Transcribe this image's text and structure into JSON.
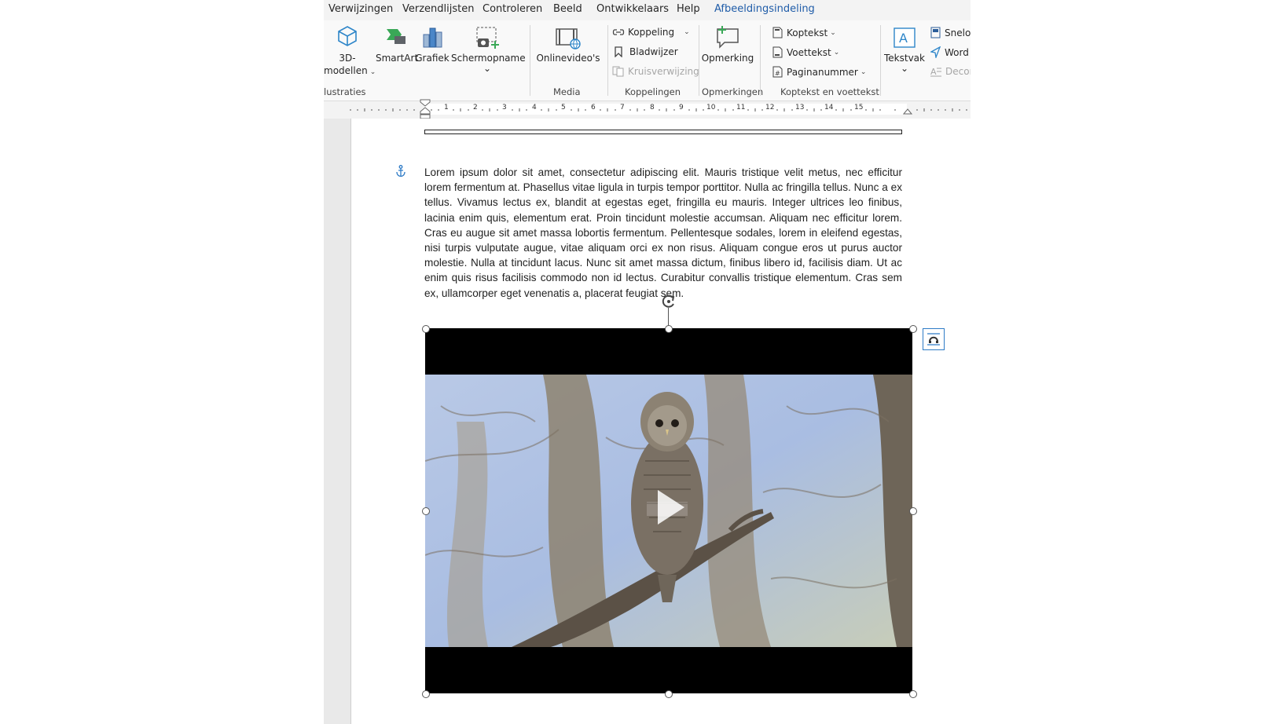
{
  "menu": {
    "items": [
      "Verwijzingen",
      "Verzendlijsten",
      "Controleren",
      "Beeld",
      "Ontwikkelaars",
      "Help",
      "Afbeeldingsindeling"
    ]
  },
  "ribbon": {
    "illustraties": {
      "models3d_line1": "3D-",
      "models3d_line2": "modellen",
      "smartart": "SmartArt",
      "grafiek": "Grafiek",
      "schermopname": "Schermopname",
      "group_label": "lustraties"
    },
    "media": {
      "onlinevideos": "Onlinevideo's",
      "group_label": "Media"
    },
    "koppelingen": {
      "koppeling": "Koppeling",
      "bladwijzer": "Bladwijzer",
      "kruisverwijzing": "Kruisverwijzing",
      "group_label": "Koppelingen"
    },
    "opmerkingen": {
      "opmerking": "Opmerking",
      "group_label": "Opmerkingen"
    },
    "koptekst": {
      "koptekst": "Koptekst",
      "voettekst": "Voettekst",
      "paginanummer": "Paginanummer",
      "group_label": "Koptekst en voettekst"
    },
    "tekst": {
      "tekstvak": "Tekstvak",
      "snelonderdelen": "Snelo",
      "wordart": "Word",
      "decor": "Decor"
    }
  },
  "ruler": {
    "numbers": [
      "1",
      "2",
      "3",
      "4",
      "5",
      "6",
      "7",
      "8",
      "9",
      "10",
      "11",
      "12",
      "13",
      "14",
      "15"
    ]
  },
  "document": {
    "paragraph": "Lorem ipsum dolor sit amet, consectetur adipiscing elit. Mauris tristique velit metus, nec efficitur lorem fermentum at. Phasellus vitae ligula in turpis tempor porttitor. Nulla ac fringilla tellus. Nunc a ex tellus. Vivamus lectus ex, blandit at egestas eget, fringilla eu mauris. Integer ultrices leo finibus, lacinia enim quis, elementum erat. Proin tincidunt molestie accumsan. Aliquam nec efficitur lorem. Cras eu augue sit amet massa lobortis fermentum. Pellentesque sodales, lorem in eleifend egestas, nisi turpis vulputate augue, vitae aliquam orci ex non risus. Aliquam congue eros ut purus auctor molestie. Nulla at tincidunt lacus. Nunc sit amet massa dictum, finibus libero id, facilisis diam. Ut ac enim quis risus facilisis commodo non id lectus. Curabitur convallis tristique elementum. Cras sem ex, ullamcorper eget venenatis a, placerat feugiat sem."
  },
  "colors": {
    "accent": "#1f5ca8",
    "video_bg": "#000000"
  }
}
